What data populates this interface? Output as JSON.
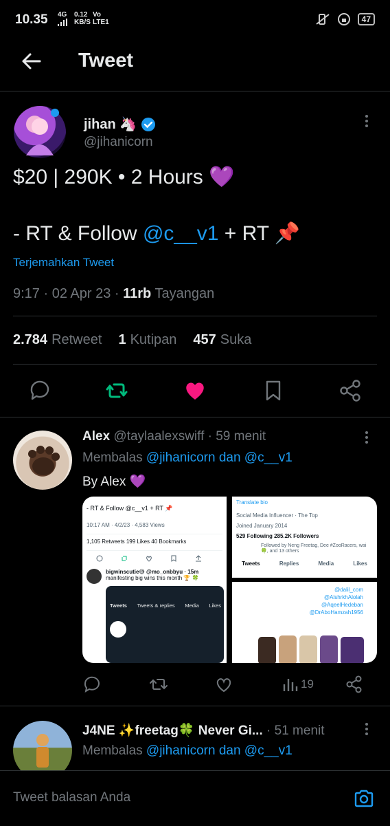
{
  "status_bar": {
    "time": "10.35",
    "network": "4G",
    "speed_value": "0.12",
    "speed_unit": "KB/S",
    "volte_top": "Vo",
    "volte_bottom": "LTE1",
    "battery": "47"
  },
  "header": {
    "title": "Tweet"
  },
  "tweet": {
    "author_name": "jihan 🦄",
    "author_handle": "@jihanicorn",
    "line1": "$20 | 290K • 2 Hours 💜",
    "line2_prefix": "- RT & Follow ",
    "line2_mention": "@c__v1",
    "line2_suffix": " + RT 📌",
    "translate": "Terjemahkan Tweet",
    "time": "9:17 · 02 Apr 23 · ",
    "views": "11rb",
    "views_label": " Tayangan",
    "retweets": "2.784",
    "retweets_label": "Retweet",
    "quotes": "1",
    "quotes_label": "Kutipan",
    "likes": "457",
    "likes_label": "Suka"
  },
  "replies": [
    {
      "name": "Alex",
      "handle": "@taylaalexswiff",
      "time": " · 59 menit",
      "replying_prefix": "Membalas ",
      "replying_to": "@jihanicorn dan @c__v1",
      "body": "By Alex 💜",
      "views": "19"
    },
    {
      "name": "J4NE ✨freetag🍀 Never Gi...",
      "time": " · 51 menit",
      "replying_prefix": "Membalas ",
      "replying_to": "@jihanicorn dan @c__v1"
    }
  ],
  "media": {
    "shot1_tweet": "- RT & Follow @c__v1 + RT 📌",
    "shot1_meta": "10:17 AM · 4/2/23 · 4,583 Views",
    "shot1_stats": "1,105 Retweets  199 Likes  40 Bookmarks",
    "shot1_user": "bigwinscutie😅 @mo_onbbyu · 15m",
    "shot1_text": "manifesting big wins this month 🏆 🍀",
    "shot1_tab_a": "Tweets",
    "shot1_tab_b": "Tweets & replies",
    "shot1_tab_c": "Media",
    "shot1_tab_d": "Likes",
    "shot2_translate": "Translate bio",
    "shot2_bio": "Social Media Influencer · The Top",
    "shot2_joined": "Joined January 2014",
    "shot2_following": "529 Following  285.2K Followers",
    "shot2_followed": "Followed by Neng Freetag, Dee #ZooRacers, wai 🍀, and 13 others",
    "shot2_tabs": [
      "Tweets",
      "Replies",
      "Media",
      "Likes"
    ],
    "shot3_handles": [
      "@dalil_com",
      "@AlshrkhAlolah",
      "@AqeelHedeban",
      "@DrAboHamzah1956"
    ]
  },
  "composer": {
    "placeholder": "Tweet balasan Anda"
  },
  "colors": {
    "accent": "#1d9bf0",
    "like": "#f91880",
    "retweet": "#00ba7c",
    "muted": "#71767b"
  }
}
